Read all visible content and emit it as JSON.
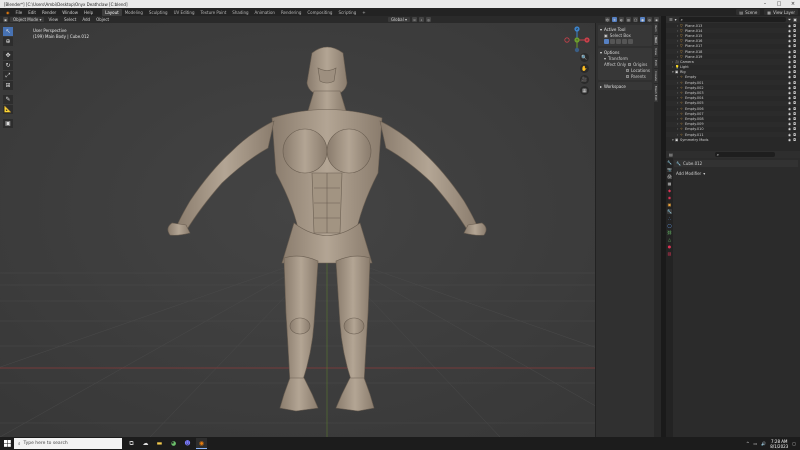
{
  "window": {
    "title": "[Blender*] [C:\\Users\\Ambi\\Desktop\\Onyx Deathclaw [C:blend]"
  },
  "menu": {
    "items": [
      "File",
      "Edit",
      "Render",
      "Window",
      "Help"
    ],
    "workspaces": [
      "Layout",
      "Modeling",
      "Sculpting",
      "UV Editing",
      "Texture Paint",
      "Shading",
      "Animation",
      "Rendering",
      "Compositing",
      "Scripting"
    ],
    "active_workspace": "Layout",
    "add_tab": "+",
    "scene": "Scene",
    "view_layer": "View Layer"
  },
  "viewport_header": {
    "mode": "Object Mode",
    "menus": [
      "View",
      "Select",
      "Add",
      "Object"
    ],
    "orientation": "Global"
  },
  "viewport": {
    "info_line1": "User Perspective",
    "info_line2": "(199) Main Body | Cube.012",
    "gizmo_axes": [
      "X",
      "Y",
      "Z"
    ]
  },
  "npanel": {
    "active_tool_title": "Active Tool",
    "active_tool_name": "Select Box",
    "options_title": "Options",
    "transform_title": "Transform",
    "affect_only_label": "Affect Only",
    "affect_items": [
      "Origins",
      "Locations",
      "Parents"
    ],
    "workspace_title": "Workspace",
    "tabs": [
      "Item",
      "Tool",
      "View",
      "Edit",
      "Create",
      "Mesh Edit"
    ]
  },
  "outliner": {
    "rows": [
      {
        "label": "Plane.013",
        "type": "mesh",
        "depth": 1
      },
      {
        "label": "Plane.014",
        "type": "mesh",
        "depth": 1
      },
      {
        "label": "Plane.015",
        "type": "mesh",
        "depth": 1
      },
      {
        "label": "Plane.016",
        "type": "mesh",
        "depth": 1
      },
      {
        "label": "Plane.017",
        "type": "mesh",
        "depth": 1
      },
      {
        "label": "Plane.018",
        "type": "mesh",
        "depth": 1
      },
      {
        "label": "Plane.019",
        "type": "mesh",
        "depth": 1
      },
      {
        "label": "Camera",
        "type": "camera",
        "depth": 0
      },
      {
        "label": "Light",
        "type": "light",
        "depth": 0
      },
      {
        "label": "Rig",
        "type": "collection",
        "depth": 0
      },
      {
        "label": "Empty",
        "type": "empty",
        "depth": 1
      },
      {
        "label": "Empty.001",
        "type": "empty",
        "depth": 1
      },
      {
        "label": "Empty.002",
        "type": "empty",
        "depth": 1
      },
      {
        "label": "Empty.003",
        "type": "empty",
        "depth": 1
      },
      {
        "label": "Empty.004",
        "type": "empty",
        "depth": 1
      },
      {
        "label": "Empty.005",
        "type": "empty",
        "depth": 1
      },
      {
        "label": "Empty.006",
        "type": "empty",
        "depth": 1
      },
      {
        "label": "Empty.007",
        "type": "empty",
        "depth": 1
      },
      {
        "label": "Empty.008",
        "type": "empty",
        "depth": 1
      },
      {
        "label": "Empty.009",
        "type": "empty",
        "depth": 1
      },
      {
        "label": "Empty.010",
        "type": "empty",
        "depth": 1
      },
      {
        "label": "Empty.011",
        "type": "empty",
        "depth": 1
      },
      {
        "label": "Symmetry Mods",
        "type": "collection",
        "depth": 0
      }
    ]
  },
  "properties": {
    "object_name": "Cube.012",
    "add_modifier_label": "Add Modifier"
  },
  "taskbar": {
    "search_placeholder": "Type here to search",
    "time": "7:28 AM",
    "date": "8/1/2023"
  },
  "colors": {
    "accent": "#4772b3",
    "x_axis": "#c9414b",
    "y_axis": "#6c9e2d",
    "z_axis": "#3d83c9",
    "viewport_bg": "#3d3d3d",
    "model": "#a89a89"
  }
}
